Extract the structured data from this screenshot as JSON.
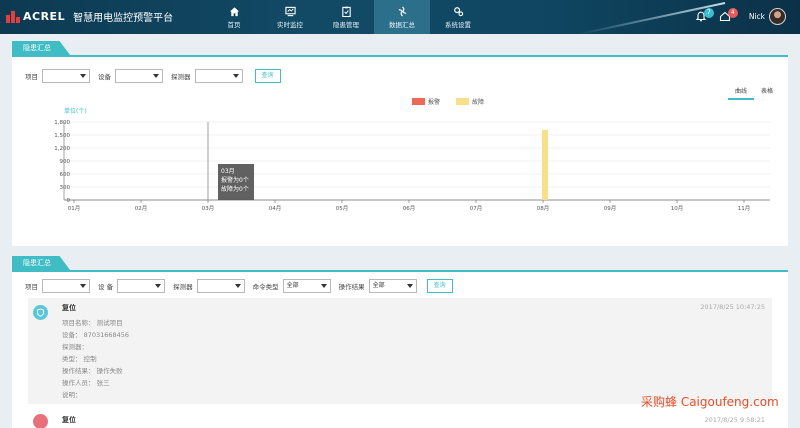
{
  "header": {
    "logo_text": "ACREL",
    "app_title": "智慧用电监控预警平台",
    "nav": [
      {
        "label": "首页",
        "icon": "home-icon"
      },
      {
        "label": "实时监控",
        "icon": "monitor-icon"
      },
      {
        "label": "隐患管理",
        "icon": "clipboard-icon"
      },
      {
        "label": "数据汇总",
        "icon": "data-summary-icon",
        "active": true
      },
      {
        "label": "系统设置",
        "icon": "gear-icon"
      }
    ],
    "bell_count": "7",
    "home_count": "4",
    "user_name": "Nick",
    "colors": {
      "bell_badge": "#3bbfd0",
      "home_badge": "#e85a5a"
    }
  },
  "summary1": {
    "tab_label": "隐患汇总",
    "filters": {
      "project_label": "项目",
      "device_label": "设备",
      "detector_label": "探测器",
      "query_button": "查询"
    },
    "view_tabs": [
      "曲线",
      "表格"
    ],
    "legend": [
      {
        "name": "报警",
        "color": "#ea6b52"
      },
      {
        "name": "故障",
        "color": "#f7e08c"
      }
    ],
    "tooltip": {
      "title": "03月",
      "line1": "报警为0个",
      "line2": "故障为0个"
    }
  },
  "chart_data": {
    "type": "bar",
    "unit_label": "单位(个)",
    "categories": [
      "01月",
      "02月",
      "03月",
      "04月",
      "05月",
      "06月",
      "07月",
      "08月",
      "09月",
      "10月",
      "11月"
    ],
    "series": [
      {
        "name": "报警",
        "values": [
          0,
          0,
          0,
          0,
          0,
          0,
          0,
          0,
          0,
          0,
          0
        ]
      },
      {
        "name": "故障",
        "values": [
          0,
          0,
          0,
          0,
          0,
          0,
          0,
          1620,
          0,
          0,
          0
        ]
      }
    ],
    "yticks": [
      "0",
      "300",
      "600",
      "900",
      "1,200",
      "1,500",
      "1,800"
    ],
    "ylim": [
      0,
      1800
    ],
    "grid": true,
    "hover_category": "03月"
  },
  "summary2": {
    "tab_label": "隐患汇总",
    "filters": {
      "project_label": "项目",
      "device_label": "设 备",
      "detector_label": "探测器",
      "command_label": "命令类型",
      "command_value": "全部",
      "result_label": "操作结果",
      "result_value": "全部",
      "query_button": "查询"
    },
    "events": [
      {
        "title": "复位",
        "time": "2017/8/25 10:47:25",
        "fields": [
          "项目名称： 测试项目",
          "设备： 87031668456",
          "探测器：",
          "类型： 控制",
          "操作结果： 操作失败",
          "操作人员： 张三",
          "说明："
        ],
        "dot_color": "#5bc7d6"
      },
      {
        "title": "复位",
        "time": "2017/8/25 9:58:21",
        "fields": [],
        "dot_color": "#e9707a"
      }
    ]
  },
  "watermark": "采购蜂 Caigoufeng.com"
}
